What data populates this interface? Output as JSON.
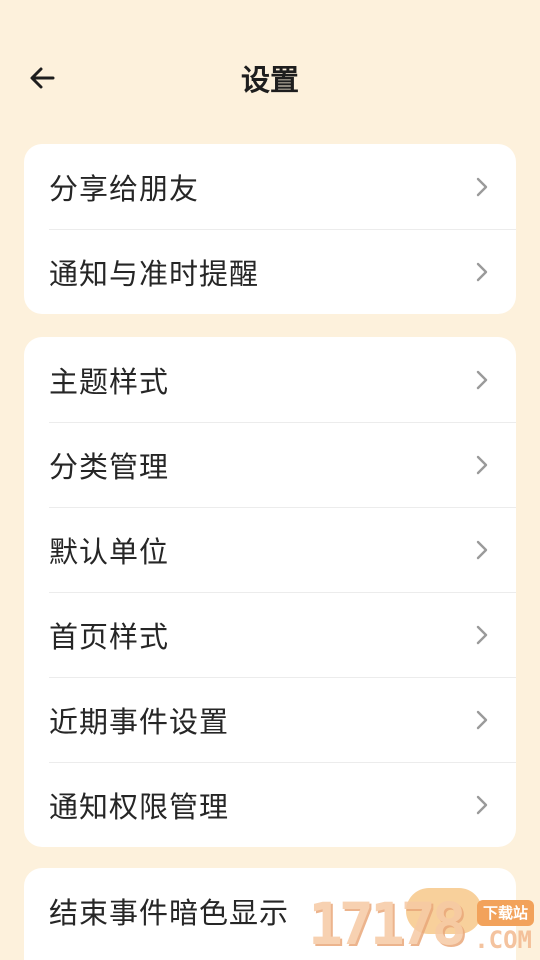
{
  "header": {
    "title": "设置",
    "back_icon": "arrow-left-icon"
  },
  "groups": [
    {
      "items": [
        {
          "label": "分享给朋友"
        },
        {
          "label": "通知与准时提醒"
        }
      ]
    },
    {
      "items": [
        {
          "label": "主题样式"
        },
        {
          "label": "分类管理"
        },
        {
          "label": "默认单位"
        },
        {
          "label": "首页样式"
        },
        {
          "label": "近期事件设置"
        },
        {
          "label": "通知权限管理"
        }
      ]
    },
    {
      "items": [
        {
          "label": "结束事件暗色显示"
        }
      ]
    }
  ],
  "watermark": {
    "digits": "17178",
    "suffix": ".COM",
    "badge": "下载站"
  },
  "colors": {
    "background": "#fdf1dc",
    "card": "#ffffff",
    "text": "#262626",
    "chevron": "#9a9a9a"
  }
}
